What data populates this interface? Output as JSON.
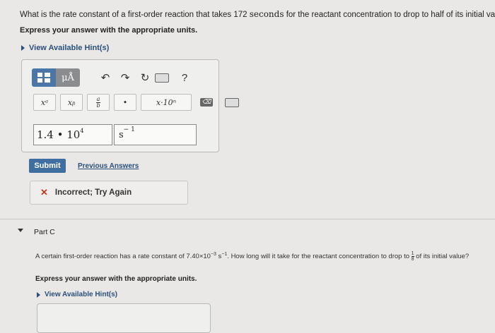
{
  "question": {
    "text_before": "What is the rate constant of a first-order reaction that takes 172 ",
    "text_unit": "seconds",
    "text_after": " for the reactant concentration to drop to half of its initial value?"
  },
  "express_label": "Express your answer with the appropriate units.",
  "hints_label": "View Available Hint(s)",
  "toolbar": {
    "mu_label": "μÅ",
    "undo": "↶",
    "redo": "↷",
    "reset": "↻",
    "help": "?",
    "xa": "xᵃ",
    "xb": "xᵦ",
    "frac_num": "a",
    "frac_den": "b",
    "dot": "•",
    "sci": "x·10ⁿ",
    "delete": "⌫"
  },
  "answer": {
    "value_base": "1.4 • 10",
    "value_exp": "4",
    "unit_base": "s",
    "unit_exp": "− 1"
  },
  "submit_label": "Submit",
  "previous_answers_label": "Previous Answers",
  "feedback": {
    "icon": "✕",
    "text": "Incorrect; Try Again",
    "color": "#c0392b"
  },
  "part_c": {
    "label": "Part C",
    "q_before": "A certain first-order reaction has a rate constant of 7.40×10",
    "q_exp1": "−3",
    "q_mid": " s",
    "q_exp2": "−1",
    "q_after": ". How long will it take for the reactant concentration to drop to ",
    "frac_num": "1",
    "frac_den": "8",
    "q_end": " of its initial value?",
    "express_label": "Express your answer with the appropriate units.",
    "hints_label": "View Available Hint(s)"
  },
  "colors": {
    "link": "#2b4f7a",
    "submit_bg": "#3f6ea1",
    "background": "#e9e8e6"
  }
}
